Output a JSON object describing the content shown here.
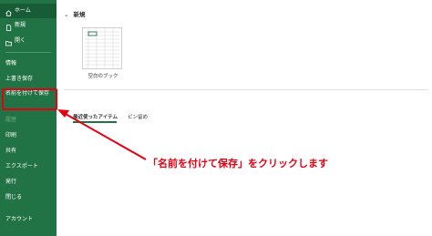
{
  "sidebar": {
    "items": [
      {
        "id": "home",
        "label": "ホーム",
        "icon": "home-icon"
      },
      {
        "id": "new",
        "label": "新規",
        "icon": "new-file-icon"
      },
      {
        "id": "open",
        "label": "開く",
        "icon": "folder-open-icon"
      },
      {
        "id": "info",
        "label": "情報"
      },
      {
        "id": "save",
        "label": "上書き保存"
      },
      {
        "id": "save-as",
        "label": "名前を付けて保存"
      },
      {
        "id": "history",
        "label": "履歴"
      },
      {
        "id": "print",
        "label": "印刷"
      },
      {
        "id": "share",
        "label": "共有"
      },
      {
        "id": "export",
        "label": "エクスポート"
      },
      {
        "id": "publish",
        "label": "発行"
      },
      {
        "id": "close",
        "label": "閉じる"
      },
      {
        "id": "account",
        "label": "アカウント"
      }
    ]
  },
  "main": {
    "section_title": "新規",
    "template_caption": "空白のブック",
    "tabs": [
      {
        "label": "最近使ったアイテム",
        "active": true
      },
      {
        "label": "ピン留め",
        "active": false
      }
    ]
  },
  "annotation": {
    "text": "「名前を付けて保存」をクリックします",
    "color": "#e60012"
  },
  "colors": {
    "sidebar_bg": "#217346",
    "sidebar_selected": "#185c37",
    "accent": "#217346"
  }
}
